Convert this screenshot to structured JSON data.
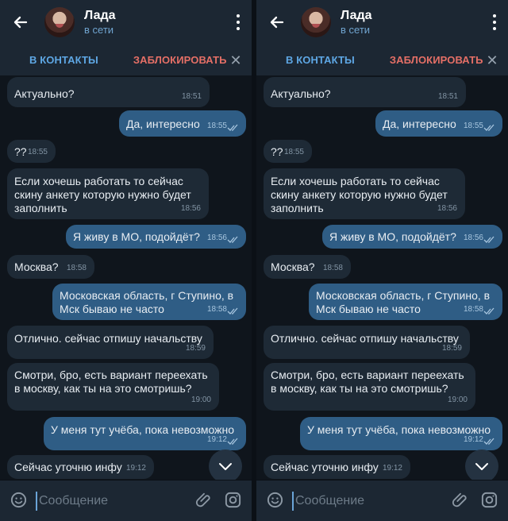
{
  "header": {
    "name": "Лада",
    "status": "в сети"
  },
  "actions": {
    "add_contact": "В КОНТАКТЫ",
    "block": "ЗАБЛОКИРОВАТЬ"
  },
  "messages": [
    {
      "text": "Актуально?",
      "time": "18:51",
      "direction": "in"
    },
    {
      "text": "Да, интересно",
      "time": "18:55",
      "direction": "out"
    },
    {
      "text": "??",
      "time": "18:55",
      "direction": "in"
    },
    {
      "text": "Если хочешь работать то сейчас\nскину анкету которую нужно будет\nзаполнить",
      "time": "18:56",
      "direction": "in"
    },
    {
      "text": "Я живу в МО, подойдёт?",
      "time": "18:56",
      "direction": "out"
    },
    {
      "text": "Москва?",
      "time": "18:58",
      "direction": "in"
    },
    {
      "text": "Московская область, г Ступино, в\nМск бываю не часто",
      "time": "18:58",
      "direction": "out"
    },
    {
      "text": "Отлично. сейчас отпишу начальству",
      "time": "18:59",
      "direction": "in"
    },
    {
      "text": "Смотри, бро, есть вариант переехать\nв москву, как ты на это смотришь?",
      "time": "19:00",
      "direction": "in"
    },
    {
      "text": "У меня тут учёба, пока невозможно",
      "time": "19:12",
      "direction": "out"
    },
    {
      "text": "Сейчас уточню инфу",
      "time": "19:12",
      "direction": "in"
    }
  ],
  "composer": {
    "placeholder": "Сообщение"
  },
  "colors": {
    "accent": "#5ea7e4",
    "danger": "#e56f66",
    "outgoing_bubble": "#2f5d85",
    "incoming_bubble": "#1e2a36"
  }
}
